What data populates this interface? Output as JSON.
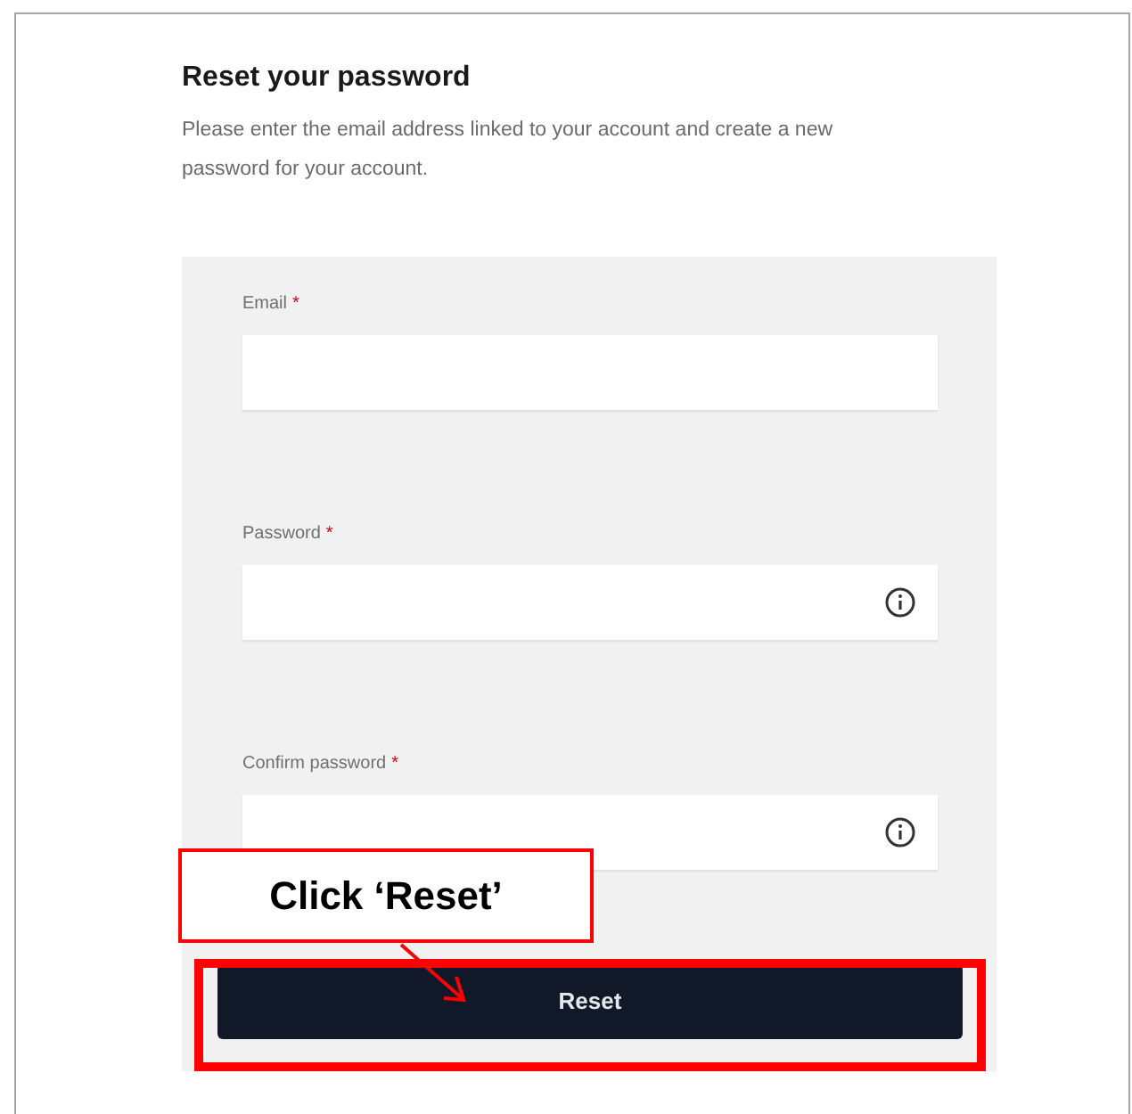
{
  "title": "Reset your password",
  "description": "Please enter the email address linked to your account and create a new password for your account.",
  "fields": [
    {
      "label": "Email",
      "required_mark": "*",
      "kind": "text"
    },
    {
      "label": "Password",
      "required_mark": "*",
      "kind": "password"
    },
    {
      "label": "Confirm password",
      "required_mark": "*",
      "kind": "password"
    }
  ],
  "button": "Reset",
  "callout": {
    "text": "Click ‘Reset’"
  }
}
